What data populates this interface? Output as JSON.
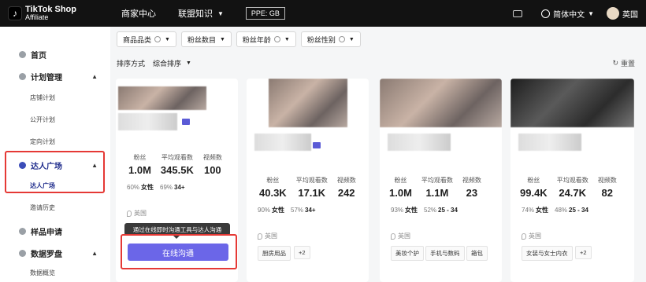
{
  "header": {
    "logo_line1": "TikTok Shop",
    "logo_line2": "Affiliate",
    "nav_merchant": "商家中心",
    "nav_knowledge": "联盟知识",
    "pill": "PPE: GB",
    "language": "简体中文",
    "region": "英国"
  },
  "sidebar": {
    "home": "首页",
    "plan_mgmt": "计划管理",
    "shop_plan": "店铺计划",
    "public_plan": "公开计划",
    "targeted_plan": "定向计划",
    "creator_plaza": "达人广场",
    "creator_plaza_sub": "达人广场",
    "invite_history": "邀请历史",
    "sample_request": "样品申请",
    "data_compass": "数据罗盘",
    "data_overview": "数据概览"
  },
  "filters": {
    "category": "商品品类",
    "followers": "粉丝数目",
    "age": "粉丝年龄",
    "gender": "粉丝性别"
  },
  "sort": {
    "label": "排序方式",
    "value": "综合排序"
  },
  "reset": "重置",
  "stat_labels": {
    "followers": "粉丝",
    "avg_views": "平均观看数",
    "videos": "视频数"
  },
  "cards": [
    {
      "followers": "1.0M",
      "avg_views": "345.5K",
      "videos": "100",
      "gender_pct": "60%",
      "gender": "女性",
      "age_pct": "69%",
      "age": "34+",
      "location": "英国",
      "tags": []
    },
    {
      "followers": "40.3K",
      "avg_views": "17.1K",
      "videos": "242",
      "gender_pct": "90%",
      "gender": "女性",
      "age_pct": "57%",
      "age": "34+",
      "location": "英国",
      "tags": [
        "厨房用品",
        "+2"
      ]
    },
    {
      "followers": "1.0M",
      "avg_views": "1.1M",
      "videos": "23",
      "gender_pct": "93%",
      "gender": "女性",
      "age_pct": "52%",
      "age": "25 - 34",
      "location": "英国",
      "tags": [
        "美妆个护",
        "手机与数码",
        "箱包"
      ]
    },
    {
      "followers": "99.4K",
      "avg_views": "24.7K",
      "videos": "82",
      "gender_pct": "74%",
      "gender": "女性",
      "age_pct": "48%",
      "age": "25 - 34",
      "location": "英国",
      "tags": [
        "女装与女士内衣",
        "+2"
      ]
    }
  ],
  "tooltip": "通过在线即时沟通工具与达人沟通",
  "cta": "在线沟通",
  "colors": {
    "accent": "#6b66e8",
    "highlight": "#e53935",
    "topbar": "#121212"
  }
}
